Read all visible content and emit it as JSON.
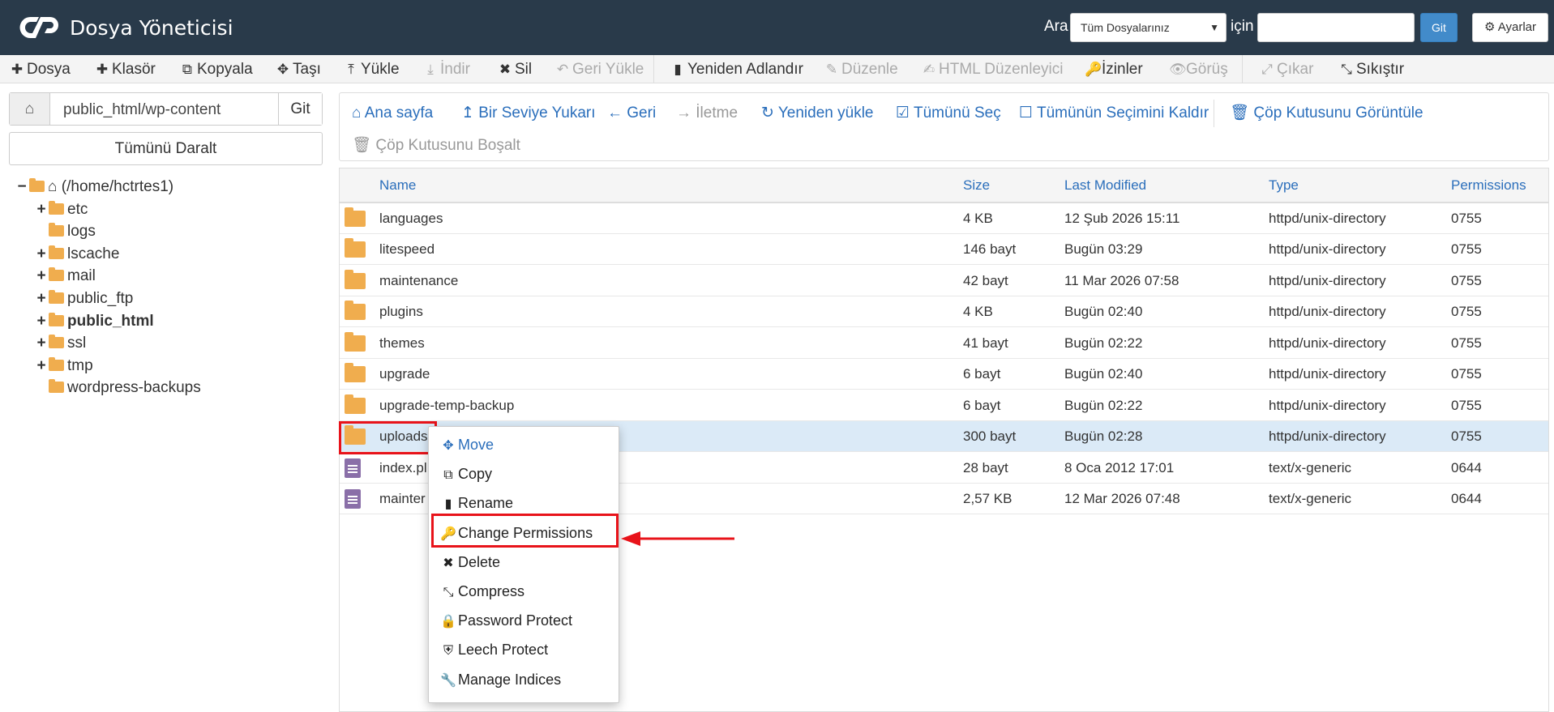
{
  "header": {
    "title": "Dosya Yöneticisi",
    "search_label": "Ara",
    "search_scope": "Tüm Dosyalarınız",
    "for_label": "için",
    "search_value": "",
    "go_label": "Git",
    "settings_label": "Ayarlar"
  },
  "toolbar": {
    "file": "Dosya",
    "folder": "Klasör",
    "copy": "Kopyala",
    "move": "Taşı",
    "upload": "Yükle",
    "download": "İndir",
    "delete": "Sil",
    "restore": "Geri Yükle",
    "rename": "Yeniden Adlandır",
    "edit": "Düzenle",
    "html_editor": "HTML Düzenleyici",
    "permissions": "İzinler",
    "view": "Görüş",
    "extract": "Çıkar",
    "compress": "Sıkıştır"
  },
  "sidebar": {
    "path": "public_html/wp-content",
    "go_label": "Git",
    "collapse_label": "Tümünü Daralt",
    "root": "(/home/hctrtes1)",
    "items": [
      {
        "label": "etc",
        "toggle": "+"
      },
      {
        "label": "logs",
        "toggle": ""
      },
      {
        "label": "lscache",
        "toggle": "+"
      },
      {
        "label": "mail",
        "toggle": "+"
      },
      {
        "label": "public_ftp",
        "toggle": "+"
      },
      {
        "label": "public_html",
        "toggle": "+"
      },
      {
        "label": "ssl",
        "toggle": "+"
      },
      {
        "label": "tmp",
        "toggle": "+"
      },
      {
        "label": "wordpress-backups",
        "toggle": ""
      }
    ]
  },
  "nav": {
    "home": "Ana sayfa",
    "up": "Bir Seviye Yukarı",
    "back": "Geri",
    "forward": "İletme",
    "reload": "Yeniden yükle",
    "select_all": "Tümünü Seç",
    "deselect_all": "Tümünün Seçimini Kaldır",
    "view_trash": "Çöp Kutusunu Görüntüle",
    "empty_trash": "Çöp Kutusunu Boşalt"
  },
  "table": {
    "headers": {
      "name": "Name",
      "size": "Size",
      "modified": "Last Modified",
      "type": "Type",
      "perms": "Permissions"
    },
    "rows": [
      {
        "name": "languages",
        "size": "4 KB",
        "modified": "12 Şub 2026 15:11",
        "type": "httpd/unix-directory",
        "perms": "0755"
      },
      {
        "name": "litespeed",
        "size": "146 bayt",
        "modified": "Bugün 03:29",
        "type": "httpd/unix-directory",
        "perms": "0755"
      },
      {
        "name": "maintenance",
        "size": "42 bayt",
        "modified": "11 Mar 2026 07:58",
        "type": "httpd/unix-directory",
        "perms": "0755"
      },
      {
        "name": "plugins",
        "size": "4 KB",
        "modified": "Bugün 02:40",
        "type": "httpd/unix-directory",
        "perms": "0755"
      },
      {
        "name": "themes",
        "size": "41 bayt",
        "modified": "Bugün 02:22",
        "type": "httpd/unix-directory",
        "perms": "0755"
      },
      {
        "name": "upgrade",
        "size": "6 bayt",
        "modified": "Bugün 02:40",
        "type": "httpd/unix-directory",
        "perms": "0755"
      },
      {
        "name": "upgrade-temp-backup",
        "size": "6 bayt",
        "modified": "Bugün 02:22",
        "type": "httpd/unix-directory",
        "perms": "0755"
      },
      {
        "name": "uploads",
        "size": "300 bayt",
        "modified": "Bugün 02:28",
        "type": "httpd/unix-directory",
        "perms": "0755"
      },
      {
        "name": "index.pl",
        "size": "28 bayt",
        "modified": "8 Oca 2012 17:01",
        "type": "text/x-generic",
        "perms": "0644"
      },
      {
        "name": "mainter",
        "size": "2,57 KB",
        "modified": "12 Mar 2026 07:48",
        "type": "text/x-generic",
        "perms": "0644"
      }
    ]
  },
  "context_menu": {
    "move": "Move",
    "copy": "Copy",
    "rename": "Rename",
    "change_permissions": "Change Permissions",
    "delete": "Delete",
    "compress": "Compress",
    "password_protect": "Password Protect",
    "leech_protect": "Leech Protect",
    "manage_indices": "Manage Indices"
  },
  "colors": {
    "header_bg": "#293a4a",
    "link_blue": "#2a6ebb",
    "folder": "#f0ad4e",
    "highlight_red": "#e8131a",
    "selected_row": "#dbeaf7"
  }
}
